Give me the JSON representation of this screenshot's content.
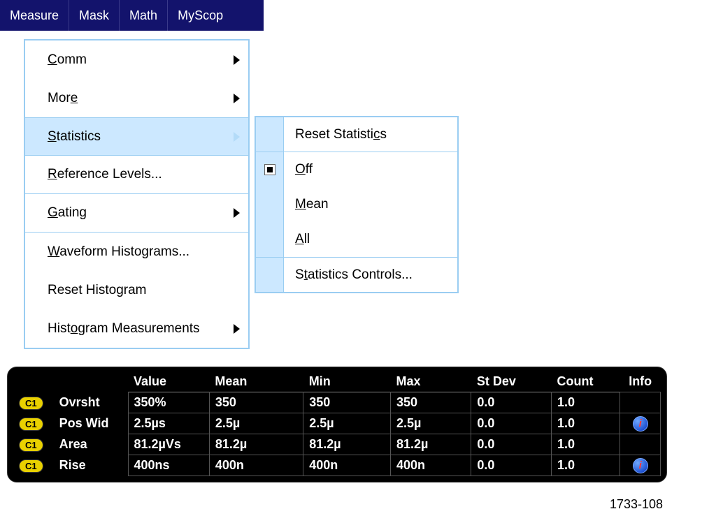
{
  "menubar": {
    "items": [
      "Measure",
      "Mask",
      "Math",
      "MyScop"
    ]
  },
  "menu": {
    "items": [
      {
        "label": "Comm",
        "ul": "C",
        "rest": "omm",
        "arrow": true
      },
      {
        "label": "More",
        "ul": "e",
        "pre": "Mor",
        "rest": "",
        "arrow": true
      },
      {
        "label": "Statistics",
        "ul": "S",
        "rest": "tatistics",
        "arrow": true,
        "highlighted": true
      },
      {
        "label": "Reference Levels...",
        "ul": "R",
        "rest": "eference Levels...",
        "sep": true
      },
      {
        "label": "Gating",
        "ul": "G",
        "rest": "ating",
        "arrow": true,
        "sep": true
      },
      {
        "label": "Waveform Histograms...",
        "ul": "W",
        "rest": "aveform Histograms...",
        "septop": true
      },
      {
        "label": "Reset Histogram",
        "plain": true
      },
      {
        "label": "Histogram Measurements",
        "ul": "o",
        "pre": "Hist",
        "rest": "gram Measurements",
        "arrow": true
      }
    ]
  },
  "submenu": {
    "items": [
      {
        "label": "Reset Statistics",
        "pre": "Reset Statisti",
        "ul": "c",
        "rest": "s",
        "sep": true
      },
      {
        "label": "Off",
        "ul": "O",
        "rest": "ff",
        "checked": true
      },
      {
        "label": "Mean",
        "ul": "M",
        "rest": "ean"
      },
      {
        "label": "All",
        "ul": "A",
        "rest": "ll",
        "sep": true
      },
      {
        "label": "Statistics Controls...",
        "pre": "S",
        "ul": "t",
        "rest": "atistics Controls...",
        "septop": true
      }
    ]
  },
  "stats": {
    "headers": [
      "Value",
      "Mean",
      "Min",
      "Max",
      "St Dev",
      "Count",
      "Info"
    ],
    "rows": [
      {
        "ch": "C1",
        "name": "Ovrsht",
        "value": "350%",
        "mean": "350",
        "min": "350",
        "max": "350",
        "stdev": "0.0",
        "count": "1.0",
        "info": false
      },
      {
        "ch": "C1",
        "name": "Pos Wid",
        "value": "2.5µs",
        "mean": "2.5µ",
        "min": "2.5µ",
        "max": "2.5µ",
        "stdev": "0.0",
        "count": "1.0",
        "info": true
      },
      {
        "ch": "C1",
        "name": "Area",
        "value": "81.2µVs",
        "mean": "81.2µ",
        "min": "81.2µ",
        "max": "81.2µ",
        "stdev": "0.0",
        "count": "1.0",
        "info": false
      },
      {
        "ch": "C1",
        "name": "Rise",
        "value": "400ns",
        "mean": "400n",
        "min": "400n",
        "max": "400n",
        "stdev": "0.0",
        "count": "1.0",
        "info": true
      }
    ]
  },
  "figure_id": "1733-108"
}
